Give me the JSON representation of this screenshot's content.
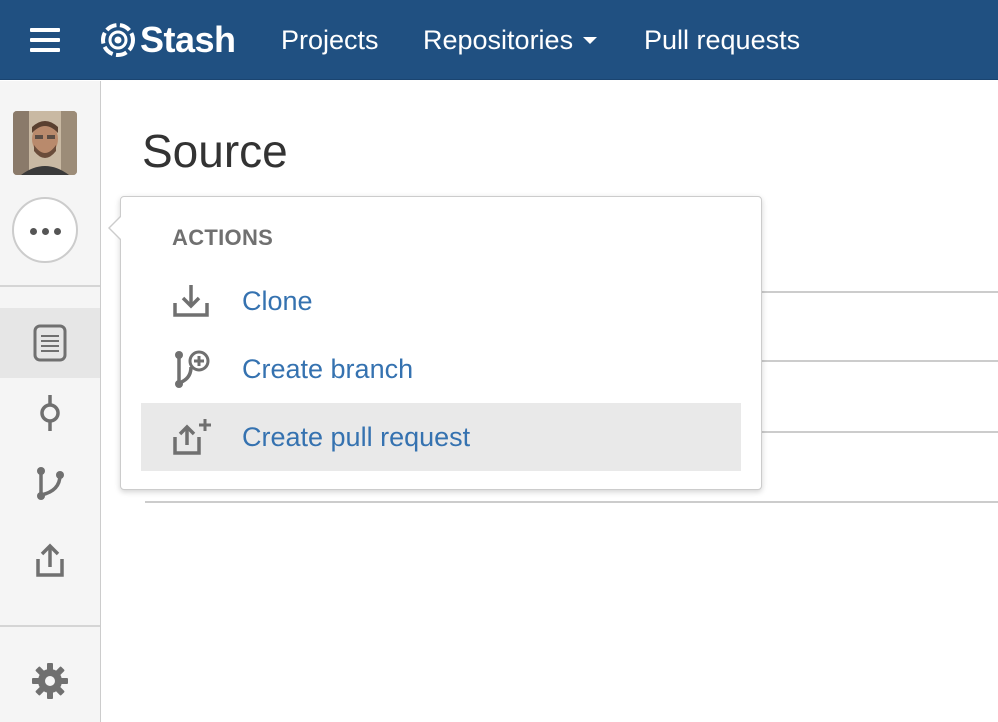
{
  "header": {
    "brand": "Stash",
    "nav": [
      {
        "label": "Projects"
      },
      {
        "label": "Repositories"
      },
      {
        "label": "Pull requests"
      }
    ]
  },
  "sidebar": {
    "items": [
      {
        "icon": "source-file-icon",
        "active": true
      },
      {
        "icon": "commit-icon"
      },
      {
        "icon": "branch-icon"
      },
      {
        "icon": "pull-request-icon"
      },
      {
        "icon": "settings-gear-icon"
      }
    ]
  },
  "main": {
    "title": "Source"
  },
  "actions_menu": {
    "heading": "ACTIONS",
    "items": [
      {
        "label": "Clone",
        "icon": "download-icon"
      },
      {
        "label": "Create branch",
        "icon": "create-branch-icon"
      },
      {
        "label": "Create pull request",
        "icon": "create-pull-request-icon",
        "highlighted": true
      }
    ]
  },
  "colors": {
    "header_bg": "#205081",
    "link": "#3572b0",
    "icon_gray": "#707070"
  }
}
